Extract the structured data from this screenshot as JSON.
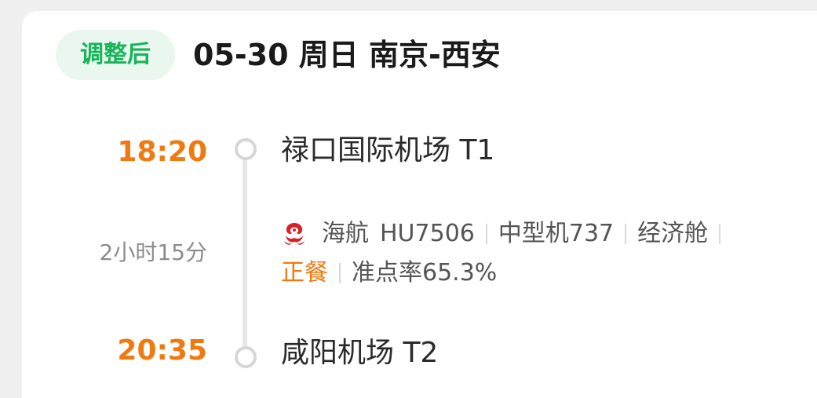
{
  "header": {
    "badge": "调整后",
    "title": "05-30 周日 南京-西安"
  },
  "departure": {
    "time": "18:20",
    "airport": "禄口国际机场 T1"
  },
  "arrival": {
    "time": "20:35",
    "airport": "咸阳机场 T2"
  },
  "duration": "2小时15分",
  "flight": {
    "airline": "海航",
    "number": "HU7506",
    "aircraft": "中型机737",
    "cabin": "经济舱",
    "meal": "正餐",
    "on_time_rate": "准点率65.3%"
  },
  "colors": {
    "accent_orange": "#f07a0f",
    "badge_green": "#17b45a",
    "badge_bg": "#e9f7ee",
    "airline_red": "#d8222a"
  },
  "icons": {
    "airline_logo": "hainan-airlines-logo-icon",
    "departure_node": "circle-node-icon",
    "arrival_node": "circle-node-icon"
  }
}
